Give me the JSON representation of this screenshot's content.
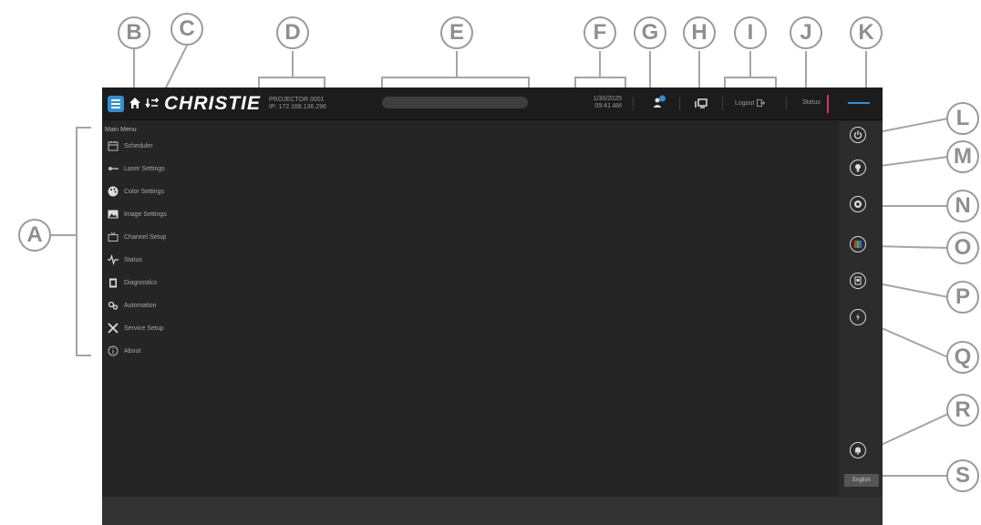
{
  "callouts": [
    "A",
    "B",
    "C",
    "D",
    "E",
    "F",
    "G",
    "H",
    "I",
    "J",
    "K",
    "L",
    "M",
    "N",
    "O",
    "P",
    "Q",
    "R",
    "S"
  ],
  "header": {
    "brand": "CHRISTIE",
    "projector_name": "PROJECTOR 0001",
    "projector_ip": "IP: 172.168.136.296",
    "date": "1/30/2025",
    "time": "09:41 AM",
    "logout_label": "Logout",
    "status_label": "Status",
    "icons": [
      "menu-icon",
      "home-icon",
      "switch-icon",
      "users-icon",
      "display-icon",
      "logout-icon"
    ]
  },
  "sidebar": {
    "title": "Main Menu",
    "items": [
      {
        "label": "Scheduler",
        "icon": "scheduler-icon"
      },
      {
        "label": "Laser Settings",
        "icon": "laser-icon"
      },
      {
        "label": "Color Settings",
        "icon": "palette-icon"
      },
      {
        "label": "Image Settings",
        "icon": "image-icon"
      },
      {
        "label": "Channel Setup",
        "icon": "tv-icon"
      },
      {
        "label": "Status",
        "icon": "pulse-icon"
      },
      {
        "label": "Diagnostics",
        "icon": "clipboard-icon"
      },
      {
        "label": "Automation",
        "icon": "gears-icon"
      },
      {
        "label": "Service Setup",
        "icon": "tools-icon"
      },
      {
        "label": "About",
        "icon": "info-icon"
      }
    ]
  },
  "rail": {
    "buttons": [
      "power-icon",
      "lightbulb-icon",
      "shutter-icon",
      "test-pattern-icon",
      "input-icon",
      "osd-icon",
      "notification-icon"
    ],
    "language_label": "English"
  },
  "colors": {
    "accent": "#2f8fd9",
    "status_indicator": "#d9336a",
    "background": "#252525",
    "topbar": "#1c1c1c"
  }
}
